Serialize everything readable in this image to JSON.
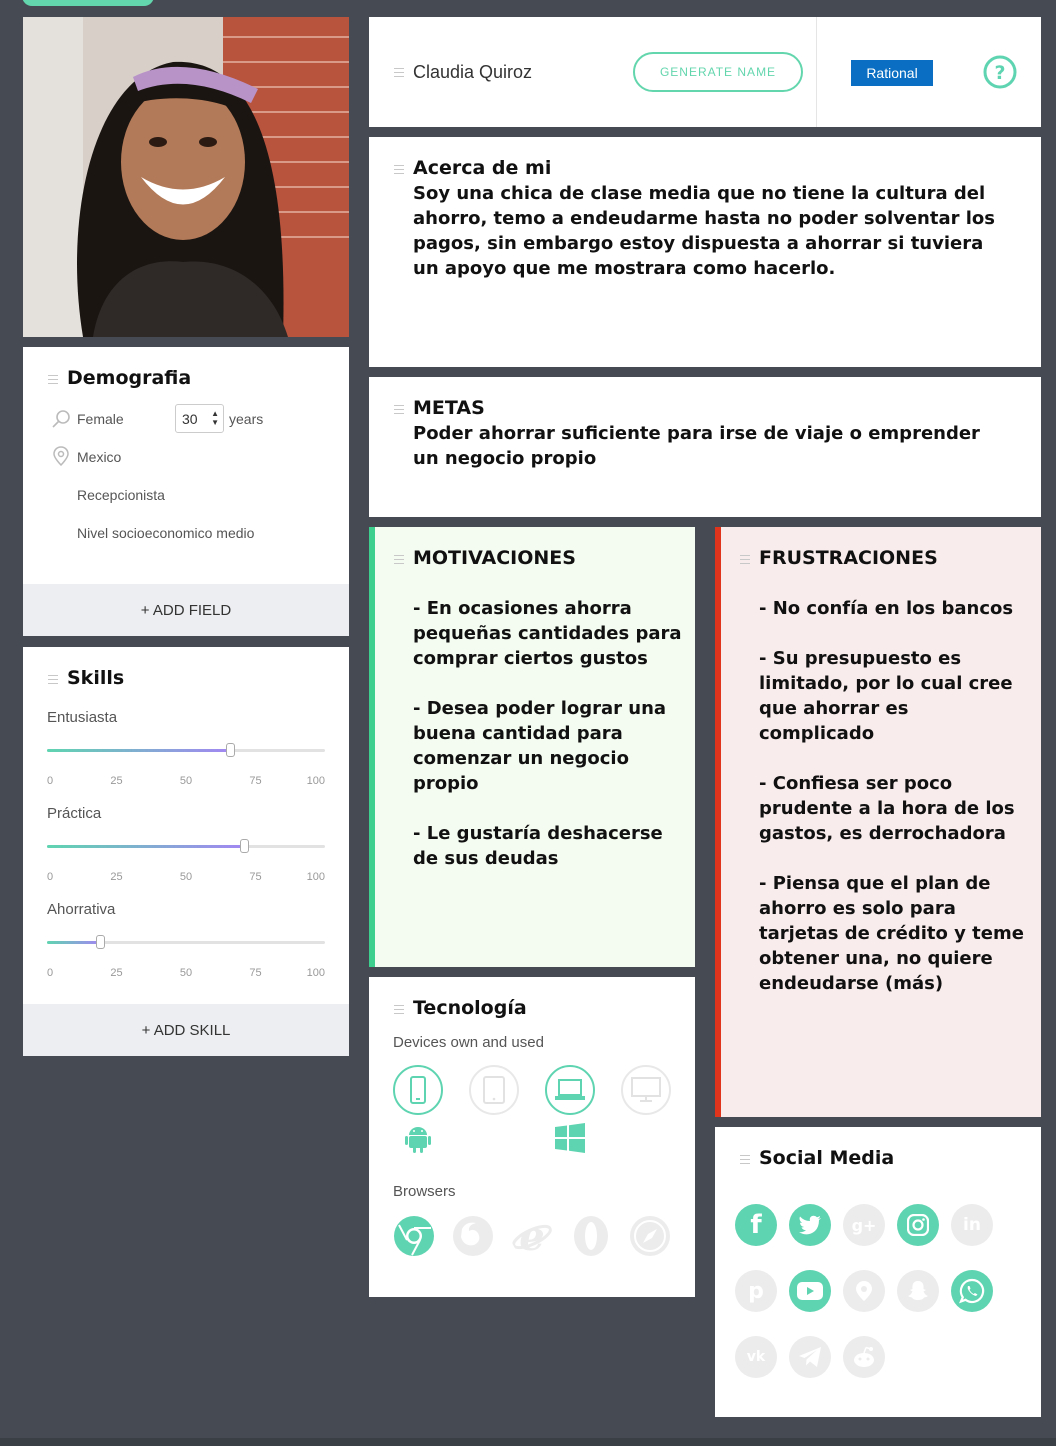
{
  "colors": {
    "accent": "#5fd4b0",
    "motivations_bar": "#3ccf8e",
    "frustrations_bar": "#e0341c",
    "tag_bg": "#0a6fc2",
    "bg": "#464a52"
  },
  "header": {
    "name": "Claudia Quiroz",
    "generate_label": "GENERATE NAME",
    "personality_tag": "Rational",
    "help_icon": "question-circle-icon"
  },
  "about": {
    "title": "Acerca de mi",
    "text": "Soy una chica de clase media que no tiene la cultura del ahorro, temo a endeudarme hasta no poder solventar los pagos, sin embargo estoy dispuesta a ahorrar si tuviera un apoyo que me mostrara como hacerlo."
  },
  "goals": {
    "title": "METAS",
    "text": "Poder ahorrar suficiente para irse de viaje o emprender un negocio propio"
  },
  "motivations": {
    "title": "MOTIVACIONES",
    "text": "- En ocasiones ahorra pequeñas cantidades para comprar ciertos gustos\n\n- Desea poder lograr una buena cantidad para comenzar un negocio propio\n\n- Le gustaría deshacerse de sus deudas"
  },
  "frustrations": {
    "title": "FRUSTRACIONES",
    "text": "- No confía en los bancos\n\n- Su presupuesto es limitado, por lo cual cree que ahorrar es complicado\n\n- Confiesa ser poco prudente a la hora de los gastos, es derrochadora\n\n- Piensa que el plan de ahorro es solo para tarjetas de crédito y teme obtener una, no quiere endeudarse (más)"
  },
  "demographics": {
    "title": "Demografia",
    "gender": "Female",
    "age": "30",
    "age_unit": "years",
    "location": "Mexico",
    "occupation": "Recepcionista",
    "socioeconomic": "Nivel socioeconomico medio",
    "add_label": "+ ADD FIELD"
  },
  "skills": {
    "title": "Skills",
    "ticks": [
      "0",
      "25",
      "50",
      "75",
      "100"
    ],
    "items": [
      {
        "label": "Entusiasta",
        "value": 66
      },
      {
        "label": "Práctica",
        "value": 71
      },
      {
        "label": "Ahorrativa",
        "value": 19
      }
    ],
    "add_label": "+ ADD SKILL"
  },
  "technology": {
    "title": "Tecnología",
    "devices_label": "Devices own and used",
    "devices": [
      {
        "icon": "smartphone-icon",
        "active": true
      },
      {
        "icon": "tablet-icon",
        "active": false
      },
      {
        "icon": "laptop-icon",
        "active": true
      },
      {
        "icon": "desktop-icon",
        "active": false
      }
    ],
    "os": [
      "android-icon",
      "windows-icon"
    ],
    "browsers_label": "Browsers",
    "browsers": [
      {
        "icon": "chrome-icon",
        "active": true
      },
      {
        "icon": "firefox-icon",
        "active": false
      },
      {
        "icon": "internet-explorer-icon",
        "active": false
      },
      {
        "icon": "opera-icon",
        "active": false
      },
      {
        "icon": "safari-icon",
        "active": false
      }
    ]
  },
  "social": {
    "title": "Social Media",
    "items": [
      {
        "icon": "facebook-icon",
        "active": true
      },
      {
        "icon": "twitter-icon",
        "active": true
      },
      {
        "icon": "google-plus-icon",
        "active": false
      },
      {
        "icon": "instagram-icon",
        "active": true
      },
      {
        "icon": "linkedin-icon",
        "active": false
      },
      {
        "icon": "pinterest-icon",
        "active": false
      },
      {
        "icon": "youtube-icon",
        "active": true
      },
      {
        "icon": "foursquare-icon",
        "active": false
      },
      {
        "icon": "snapchat-icon",
        "active": false
      },
      {
        "icon": "whatsapp-icon",
        "active": true
      },
      {
        "icon": "vk-icon",
        "active": false
      },
      {
        "icon": "telegram-icon",
        "active": false
      },
      {
        "icon": "reddit-icon",
        "active": false
      }
    ]
  }
}
